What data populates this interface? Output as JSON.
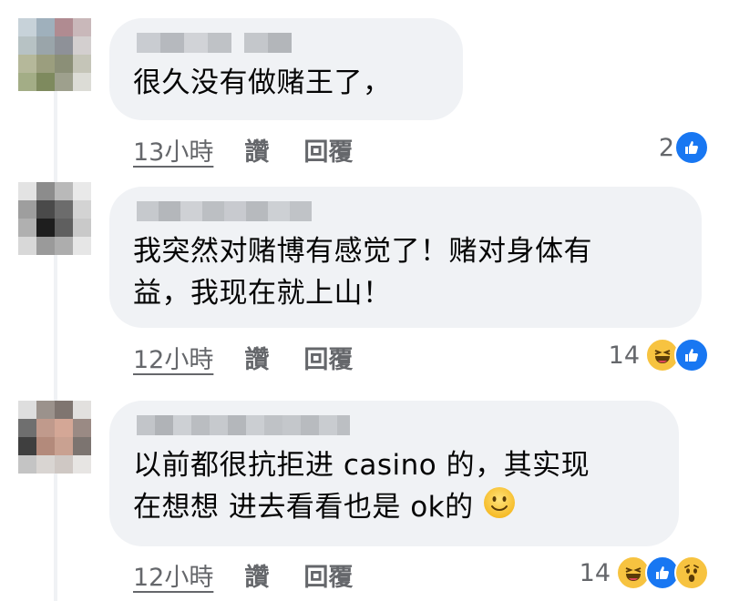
{
  "comments": [
    {
      "text": "很久没有做赌王了，",
      "time": "13小時",
      "like_label": "讚",
      "reply_label": "回覆",
      "reaction_count": "2",
      "reactions": [
        "like"
      ]
    },
    {
      "text": "我突然对赌博有感觉了！赌对身体有\n益，我现在就上山！",
      "time": "12小時",
      "like_label": "讚",
      "reply_label": "回覆",
      "reaction_count": "14",
      "reactions": [
        "haha",
        "like"
      ]
    },
    {
      "text_line1": "以前都很抗拒进 casino 的，其实现",
      "text_line2": "在想想 进去看看也是 ok的",
      "time": "12小時",
      "like_label": "讚",
      "reply_label": "回覆",
      "reaction_count": "14",
      "reactions": [
        "haha",
        "like",
        "wow"
      ]
    }
  ],
  "colors": {
    "bubble": "#f0f2f5",
    "meta_text": "#65676b",
    "like_blue": "#1877f2",
    "emoji_yellow": "#f7c340"
  }
}
